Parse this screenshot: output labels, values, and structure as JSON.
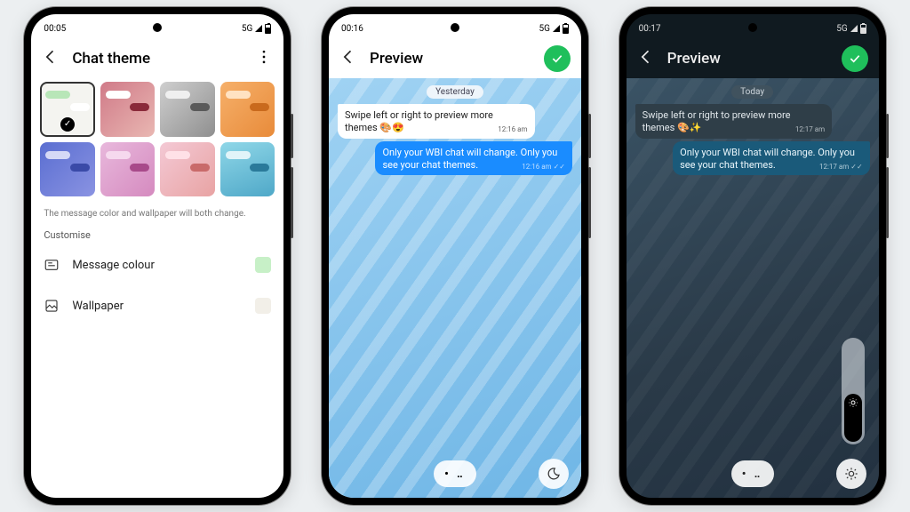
{
  "status": {
    "net": "5G"
  },
  "phone1": {
    "time": "00:05",
    "title": "Chat theme",
    "themes": [
      {
        "bg": "#f4f4f0",
        "a": "#b8e6b8",
        "b": "#ffffff",
        "selected": true
      },
      {
        "bg": "linear-gradient(135deg,#d07a88,#e9b7b2)",
        "a": "#ffffff",
        "b": "#8a2a3a"
      },
      {
        "bg": "linear-gradient(135deg,#cfcfcf,#8f8f8f)",
        "a": "#efefef",
        "b": "#5a5a5a"
      },
      {
        "bg": "linear-gradient(135deg,#f6b06a,#e88b3a)",
        "a": "#ffe2c2",
        "b": "#c96a1d"
      },
      {
        "bg": "linear-gradient(135deg,#5a6ed1,#8a93e2)",
        "a": "#d5d9f6",
        "b": "#3a4aa8"
      },
      {
        "bg": "linear-gradient(135deg,#e8b8dc,#d58abf)",
        "a": "#f6d9ee",
        "b": "#a84a8a"
      },
      {
        "bg": "linear-gradient(135deg,#f4c9d5,#e8a3a3)",
        "a": "#ffe1e7",
        "b": "#c96a6a"
      },
      {
        "bg": "linear-gradient(160deg,#8fd7e8,#4fa8c8)",
        "a": "#e1f4f9",
        "b": "#2a7a9a"
      }
    ],
    "hint": "The message color and wallpaper will both change.",
    "customise_label": "Customise",
    "message_colour": {
      "label": "Message colour",
      "swatch": "#c7f0c7"
    },
    "wallpaper": {
      "label": "Wallpaper",
      "swatch": "#f2efe8"
    }
  },
  "phone2": {
    "time": "00:16",
    "title": "Preview",
    "date_chip": "Yesterday",
    "msg_in": {
      "text": "Swipe left or right to preview more themes 🎨😍",
      "time": "12:16 am"
    },
    "msg_out": {
      "text": "Only your WBI chat will change. Only you see your chat themes.",
      "time": "12:16 am"
    },
    "pager": "• ‥",
    "mode_icon": "moon"
  },
  "phone3": {
    "time": "00:17",
    "title": "Preview",
    "date_chip": "Today",
    "msg_in": {
      "text": "Swipe left or right to preview more themes 🎨✨",
      "time": "12:17 am"
    },
    "msg_out": {
      "text": "Only your WBI chat will change. Only you see your chat themes.",
      "time": "12:17 am"
    },
    "pager": "• ‥",
    "mode_icon": "sun"
  }
}
